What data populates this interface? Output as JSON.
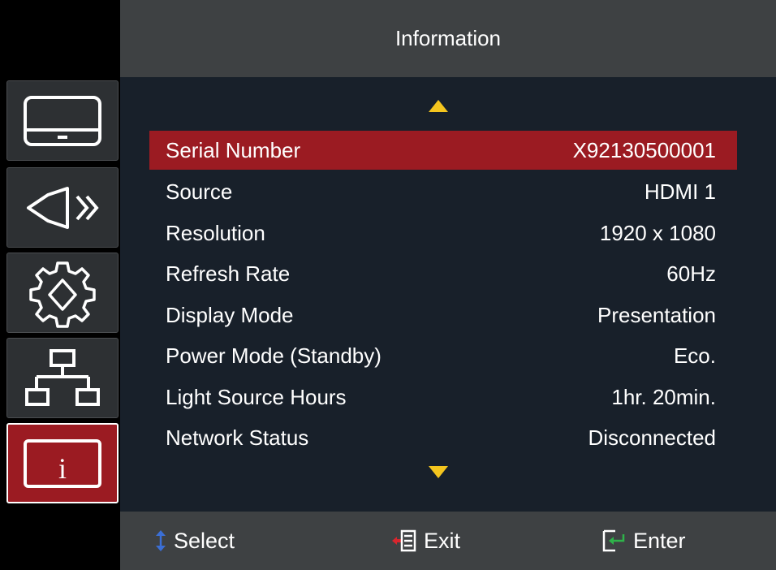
{
  "header": {
    "title": "Information"
  },
  "sidebar": {
    "items": [
      {
        "icon": "display-icon",
        "active": false
      },
      {
        "icon": "audio-icon",
        "active": false
      },
      {
        "icon": "settings-gear-icon",
        "active": false
      },
      {
        "icon": "network-icon",
        "active": false
      },
      {
        "icon": "info-icon",
        "active": true,
        "glyph": "i"
      }
    ]
  },
  "info": {
    "rows": [
      {
        "label": "Serial Number",
        "value": "X92130500001"
      },
      {
        "label": "Source",
        "value": "HDMI 1"
      },
      {
        "label": "Resolution",
        "value": "1920 x 1080"
      },
      {
        "label": "Refresh Rate",
        "value": "60Hz"
      },
      {
        "label": "Display Mode",
        "value": "Presentation"
      },
      {
        "label": "Power Mode (Standby)",
        "value": "Eco."
      },
      {
        "label": "Light Source Hours",
        "value": "1hr. 20min."
      },
      {
        "label": "Network Status",
        "value": "Disconnected"
      }
    ]
  },
  "footer": {
    "select_label": "Select",
    "exit_label": "Exit",
    "enter_label": "Enter"
  },
  "colors": {
    "accent": "#9b1b22",
    "arrow": "#f4c51e",
    "panel": "#18202a",
    "bar": "#3e4143"
  }
}
